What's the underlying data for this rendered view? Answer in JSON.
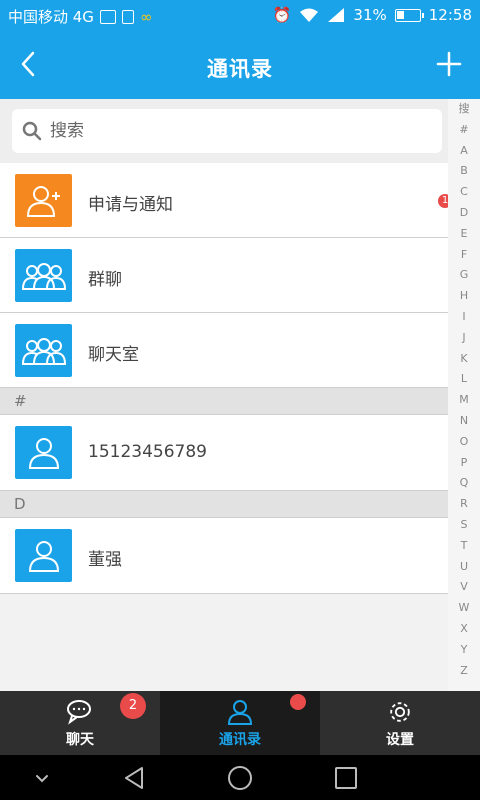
{
  "status_bar": {
    "carrier": "中国移动 4G",
    "battery": "31%",
    "time": "12:58"
  },
  "header": {
    "title": "通讯录",
    "back_icon": "back-chevron-icon",
    "add_icon": "plus-icon"
  },
  "search": {
    "placeholder": "搜索"
  },
  "contacts": {
    "special": [
      {
        "label": "申请与通知",
        "icon": "add-person-icon",
        "color": "#f5891f"
      },
      {
        "label": "群聊",
        "icon": "group-icon",
        "color": "#1aa3e8"
      },
      {
        "label": "聊天室",
        "icon": "group-icon",
        "color": "#1aa3e8"
      }
    ],
    "sections": [
      {
        "header": "#",
        "items": [
          {
            "label": "15123456789"
          }
        ]
      },
      {
        "header": "D",
        "items": [
          {
            "label": "董强"
          }
        ]
      }
    ],
    "notification_badge": "1"
  },
  "index_bar": [
    "搜",
    "#",
    "A",
    "B",
    "C",
    "D",
    "E",
    "F",
    "G",
    "H",
    "I",
    "J",
    "K",
    "L",
    "M",
    "N",
    "O",
    "P",
    "Q",
    "R",
    "S",
    "T",
    "U",
    "V",
    "W",
    "X",
    "Y",
    "Z"
  ],
  "tabs": [
    {
      "label": "聊天",
      "icon": "chat-bubbles-icon",
      "badge": "2",
      "active": false
    },
    {
      "label": "通讯录",
      "icon": "contacts-person-icon",
      "dot": true,
      "active": true
    },
    {
      "label": "设置",
      "icon": "gear-icon",
      "active": false
    }
  ],
  "colors": {
    "accent": "#1aa3e8",
    "orange": "#f5891f",
    "badge": "#e94b4b",
    "tabbar_bg": "#2f2f2f"
  }
}
